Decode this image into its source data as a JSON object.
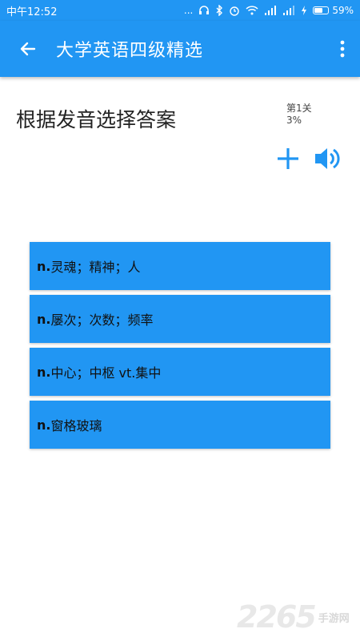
{
  "status_bar": {
    "time": "中午12:52",
    "dots": "...",
    "battery": "59%",
    "battery_level": 0.59
  },
  "app_bar": {
    "title": "大学英语四级精选"
  },
  "quiz": {
    "prompt": "根据发音选择答案",
    "level": "第1关",
    "progress": "3%",
    "options": [
      {
        "pos": "n.",
        "text": "灵魂；精神；人"
      },
      {
        "pos": "n.",
        "text": "屡次；次数；频率"
      },
      {
        "pos": "n.",
        "text": "中心；中枢 vt.集中"
      },
      {
        "pos": "n.",
        "text": "窗格玻璃"
      }
    ]
  },
  "watermark": {
    "number": "2265",
    "text": "手游网"
  },
  "colors": {
    "primary": "#2196f3",
    "text": "#222222"
  }
}
